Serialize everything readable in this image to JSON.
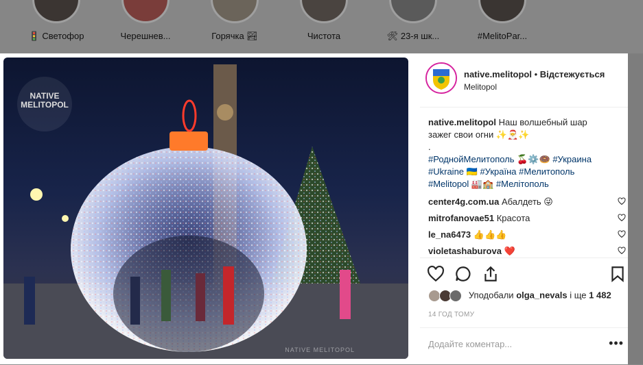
{
  "stories": [
    {
      "label": "🚦 Светофор"
    },
    {
      "label": "Черешнев..."
    },
    {
      "label": "Горячка 🏞"
    },
    {
      "label": "Чистота"
    },
    {
      "label": "🛠 23-я шк..."
    },
    {
      "label": "#MelitoPar..."
    }
  ],
  "photo": {
    "watermark_lines": [
      "NATIVE",
      "MELITOPOL"
    ],
    "watermark_bottom": "NATIVE MELITOPOL"
  },
  "post": {
    "username": "native.melitopol",
    "separator": " • ",
    "follow_label": "Відстежується",
    "location": "Melitopol",
    "caption_user": "native.melitopol",
    "caption_text": " Наш волшебный шар зажег свои огни ✨🎅✨",
    "caption_dot": ".",
    "hashtags_line1": [
      "#РоднойМелитополь 🍒⚙️🍩",
      "#Украина"
    ],
    "hashtags_line2": [
      "#Ukraine 🇺🇦",
      "#Україна",
      "#Мелитополь"
    ],
    "hashtags_line3": [
      "#Melitopol 🏭🏫",
      "#Мелітополь"
    ]
  },
  "comments": [
    {
      "user": "center4g.com.ua",
      "text": "Абалдеть 😜"
    },
    {
      "user": "mitrofanovae51",
      "text": "Красота"
    },
    {
      "user": "le_na6473",
      "text": "👍👍👍"
    },
    {
      "user": "violetashaburova",
      "text": "❤️"
    }
  ],
  "likes": {
    "prefix": "Уподобали ",
    "user": "olga_nevals",
    "mid": " і ще ",
    "count": "1 482"
  },
  "time": "14 ГОД ТОМУ",
  "add_comment_placeholder": "Додайте коментар...",
  "more_label": "•••",
  "icons": {
    "like": "heart-icon",
    "comment": "comment-icon",
    "share": "share-icon",
    "save": "bookmark-icon"
  },
  "colors": {
    "tag": "#003569",
    "heart_red": "#ed4956"
  }
}
